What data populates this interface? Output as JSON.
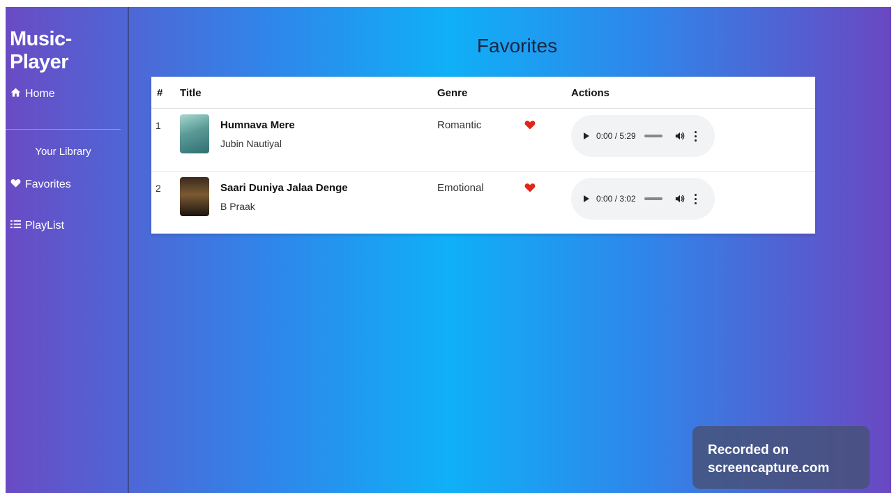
{
  "app": {
    "brand": "Music-Player"
  },
  "sidebar": {
    "home_label": "Home",
    "library_label": "Your Library",
    "favorites_label": "Favorites",
    "playlist_label": "PlayList",
    "icons": [
      "home-icon",
      "heart-icon",
      "list-icon"
    ]
  },
  "main": {
    "title": "Favorites",
    "columns": [
      "#",
      "Title",
      "Genre",
      "Actions"
    ],
    "rows": [
      {
        "index": "1",
        "title": "Humnava Mere",
        "artist": "Jubin Nautiyal",
        "genre": "Romantic",
        "time": "0:00 / 5:29",
        "favorite": true,
        "progress": 0
      },
      {
        "index": "2",
        "title": "Saari Duniya Jalaa Denge",
        "artist": "B Praak",
        "genre": "Emotional",
        "time": "0:00 / 3:02",
        "favorite": true,
        "progress": 0
      }
    ]
  },
  "watermark": {
    "line1": "Recorded on",
    "line2": "screencapture.com"
  },
  "colors": {
    "heart": "#e0261b",
    "gradient_mid": "#0fb0f7",
    "gradient_edge": "#6a4bc4"
  }
}
